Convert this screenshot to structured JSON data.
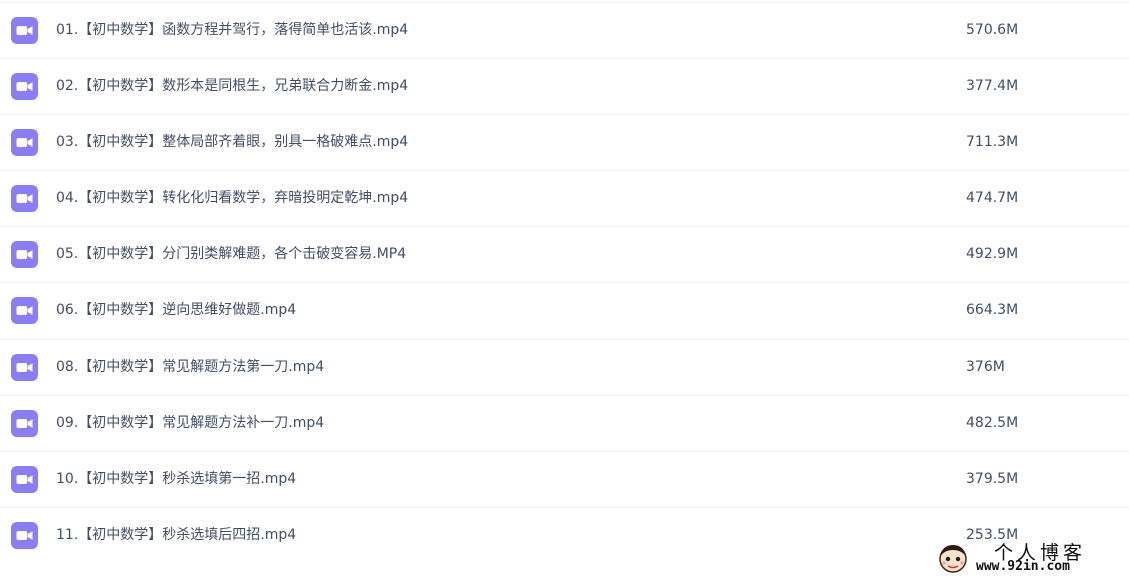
{
  "files": [
    {
      "name": "01.【初中数学】函数方程并驾行，落得简单也活该.mp4",
      "size": "570.6M",
      "icon": "video-file-icon"
    },
    {
      "name": "02.【初中数学】数形本是同根生，兄弟联合力断金.mp4",
      "size": "377.4M",
      "icon": "video-file-icon"
    },
    {
      "name": "03.【初中数学】整体局部齐着眼，别具一格破难点.mp4",
      "size": "711.3M",
      "icon": "video-file-icon"
    },
    {
      "name": "04.【初中数学】转化化归看数学，弃暗投明定乾坤.mp4",
      "size": "474.7M",
      "icon": "video-file-icon"
    },
    {
      "name": "05.【初中数学】分门别类解难题，各个击破变容易.MP4",
      "size": "492.9M",
      "icon": "video-file-icon"
    },
    {
      "name": "06.【初中数学】逆向思维好做题.mp4",
      "size": "664.3M",
      "icon": "video-file-icon"
    },
    {
      "name": "08.【初中数学】常见解题方法第一刀.mp4",
      "size": "376M",
      "icon": "video-file-icon"
    },
    {
      "name": "09.【初中数学】常见解题方法补一刀.mp4",
      "size": "482.5M",
      "icon": "video-file-icon"
    },
    {
      "name": "10.【初中数学】秒杀选填第一招.mp4",
      "size": "379.5M",
      "icon": "video-file-icon"
    },
    {
      "name": "11.【初中数学】秒杀选填后四招.mp4",
      "size": "253.5M",
      "icon": "video-file-icon"
    }
  ],
  "watermark": {
    "title": "个人博客",
    "url": "www.92in.com"
  },
  "colors": {
    "icon_purple": "#8a7df5",
    "text": "#424e67",
    "divider": "#f0f0f3"
  }
}
